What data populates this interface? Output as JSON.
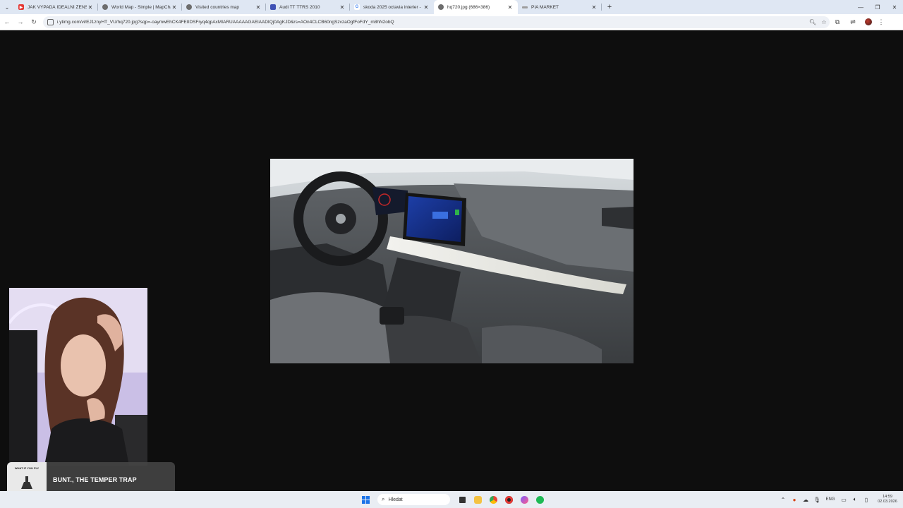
{
  "browser": {
    "tabs": [
      {
        "title": "JAK VYPADÁ IDEÁLNÍ ŽENSKÁ",
        "favicon_color": "#e53935",
        "favicon": "youtube-icon",
        "active": false
      },
      {
        "title": "World Map - Simple | MapChar",
        "favicon_color": "#6d6d6d",
        "favicon": "globe-icon",
        "active": false
      },
      {
        "title": "Visited countries map",
        "favicon_color": "#6d6d6d",
        "favicon": "globe-icon",
        "active": false
      },
      {
        "title": "Audi TT TTRS 2010",
        "favicon_color": "#3f51b5",
        "favicon": "car-icon",
        "active": false
      },
      {
        "title": "skoda 2025 octavia interier - H",
        "favicon_color": "#4285f4",
        "favicon": "google-icon",
        "active": false
      },
      {
        "title": "hq720.jpg (686×386)",
        "favicon_color": "#6d6d6d",
        "favicon": "globe-icon",
        "active": true
      },
      {
        "title": "PIA MARKET",
        "favicon_color": "#9e9e9e",
        "favicon": "page-icon",
        "active": false
      }
    ],
    "url": "i.ytimg.com/vi/EJ1znyHT_VU/hq720.jpg?sqp=-oaymwEhCK4FEIIDSFryq4qpAxMIARUAAAAAGAElAADIQj0AgKJD&rs=AOn4CLCB60ngSzvzaOgfFoFdY_m8hN2obQ"
  },
  "now_playing": {
    "title": "BUNT., THE TEMPER TRAP",
    "cover_text": "WHAT IF YOU FLY"
  },
  "taskbar": {
    "search_placeholder": "Hledat",
    "language": "ENG",
    "time": "14:59",
    "date": "02.03.2026"
  },
  "colors": {
    "accent": "#1a73e8",
    "viewer_bg": "#0e0e0e"
  }
}
